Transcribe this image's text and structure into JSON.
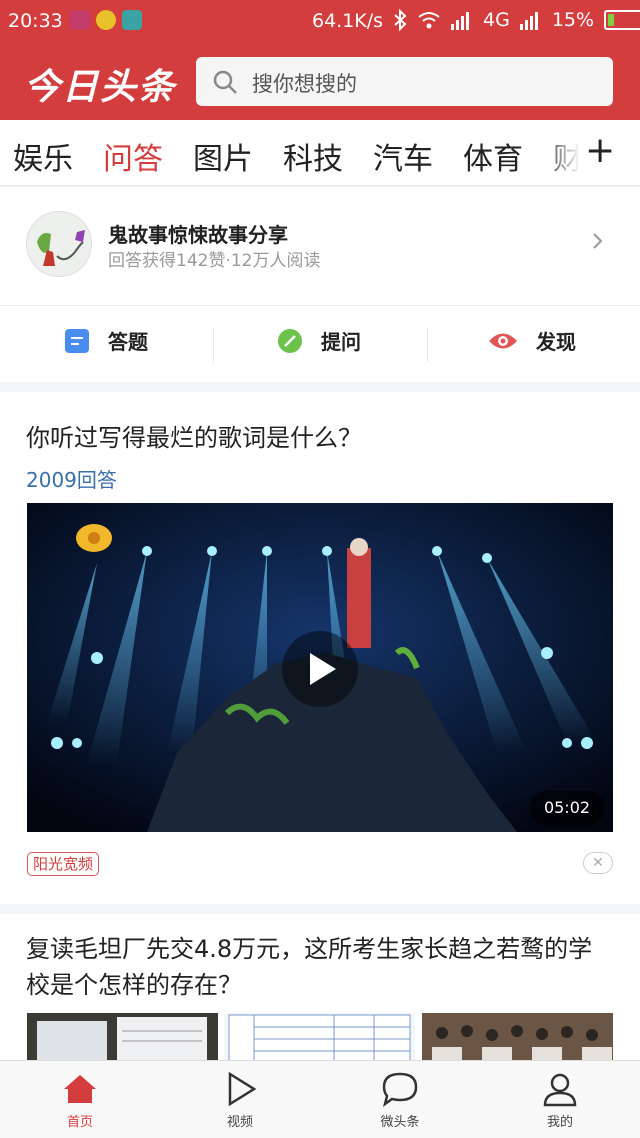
{
  "status_bar": {
    "time": "20:33",
    "network_speed": "64.1K/s",
    "network_type": "4G",
    "battery": "15%",
    "battery_level": 0.15
  },
  "header": {
    "logo": "今日头条",
    "search_placeholder": "搜你想搜的"
  },
  "channel_tabs": {
    "items": [
      "娱乐",
      "问答",
      "图片",
      "科技",
      "汽车",
      "体育",
      "财"
    ],
    "active": "问答"
  },
  "profile": {
    "name": "鬼故事惊悚故事分享",
    "stats": "回答获得142赞·12万人阅读",
    "actions": [
      "答题",
      "提问",
      "发现"
    ]
  },
  "feed": [
    {
      "question": "你听过写得最烂的歌词是什么？",
      "answers": "2009回答",
      "video_duration": "05:02",
      "source_tag": "阳光宽频"
    },
    {
      "question": "复读毛坦厂先交4.8万元，这所考生家长趋之若鹜的学校是个怎样的存在？"
    }
  ],
  "bottom_nav": {
    "items": [
      "首页",
      "视频",
      "微头条",
      "我的"
    ],
    "active": "首页"
  },
  "colors": {
    "brand_red": "#d43d3d",
    "link_blue": "#3a6ea8",
    "answer_icon": "#4a8df0",
    "ask_icon": "#6cc24a",
    "discover_icon": "#e05555"
  },
  "icons": [
    "search-icon",
    "chevron-right-icon",
    "answer-icon",
    "ask-pencil-icon",
    "discover-eye-icon",
    "play-icon",
    "close-icon",
    "home-icon",
    "video-icon",
    "weitoutiao-icon",
    "profile-icon",
    "bluetooth-icon",
    "wifi-icon",
    "signal-icon",
    "battery-icon"
  ]
}
